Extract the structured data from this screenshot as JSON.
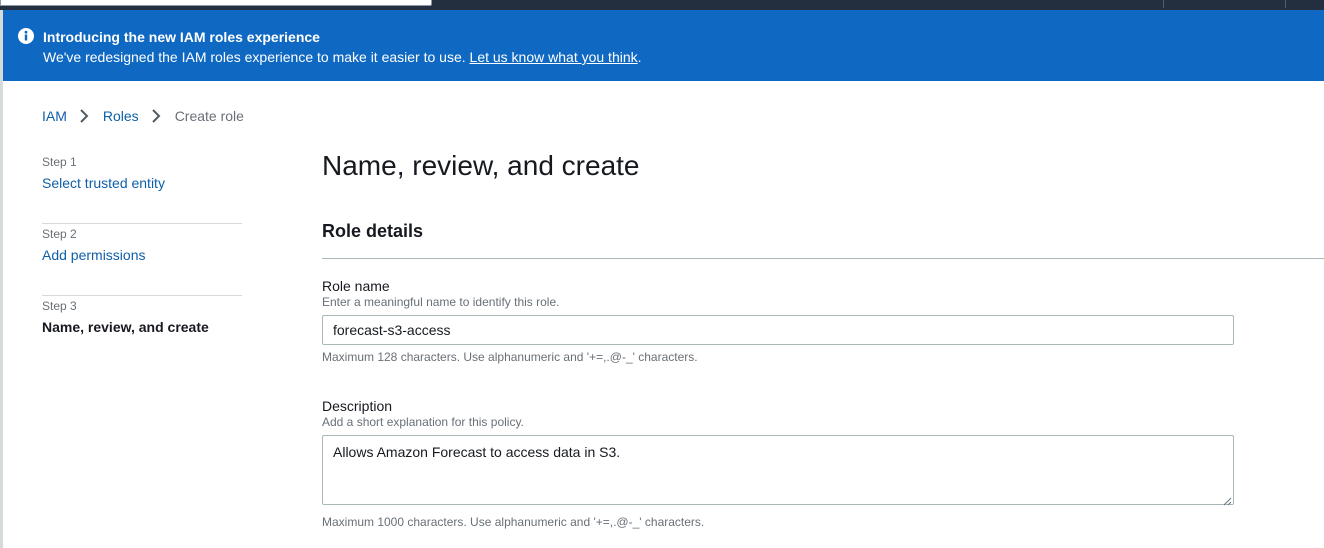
{
  "flashbar": {
    "title": "Introducing the new IAM roles experience",
    "message": "We've redesigned the IAM roles experience to make it easier to use. ",
    "link_text": "Let us know what you think",
    "message_suffix": ".",
    "icon": "info-icon",
    "background_color": "#0f68c2"
  },
  "breadcrumb": {
    "items": [
      {
        "label": "IAM"
      },
      {
        "label": "Roles"
      },
      {
        "label": "Create role"
      }
    ],
    "separator_icon": "chevron-right-icon"
  },
  "steps": [
    {
      "number": "Step 1",
      "label": "Select trusted entity"
    },
    {
      "number": "Step 2",
      "label": "Add permissions"
    },
    {
      "number": "Step 3",
      "label": "Name, review, and create"
    }
  ],
  "main": {
    "title": "Name, review, and create",
    "section_title": "Role details",
    "role_name": {
      "label": "Role name",
      "description": "Enter a meaningful name to identify this role.",
      "value": "forecast-s3-access",
      "constraint": "Maximum 128 characters. Use alphanumeric and '+=,.@-_' characters."
    },
    "description": {
      "label": "Description",
      "description": "Add a short explanation for this policy.",
      "value": "Allows Amazon Forecast to access data in S3.",
      "constraint": "Maximum 1000 characters. Use alphanumeric and '+=,.@-_' characters."
    }
  },
  "colors": {
    "link": "#0f5fa8",
    "top_bar": "#232f3e",
    "text": "#16191f",
    "muted": "#687078"
  }
}
